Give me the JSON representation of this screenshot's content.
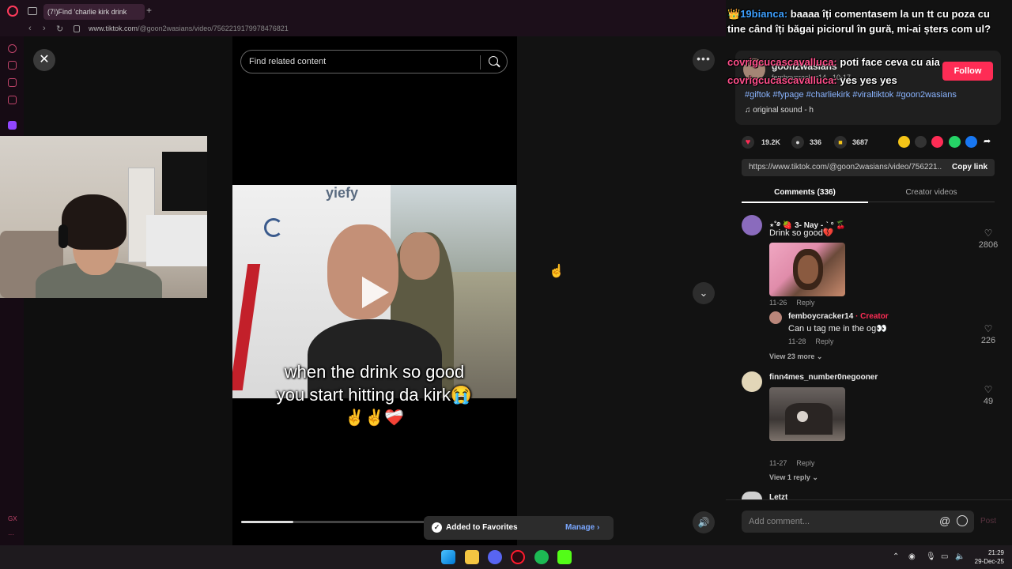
{
  "browser": {
    "tab_title": "(7!)Find 'charlie kirk drink",
    "url_host": "www.tiktok.com",
    "url_path": "/@goon2wasians/video/7562219179978476821"
  },
  "search": {
    "placeholder": "Find related content"
  },
  "video": {
    "caption_line1": "when the drink so good",
    "caption_line2": "you start hitting da kirk😭",
    "caption_emoji": "✌️✌️❤️‍🩹",
    "brand_text": "yiefy",
    "progress": 0.2
  },
  "toast": {
    "message": "Added to Favorites",
    "action": "Manage",
    "chevron": "›"
  },
  "controls": {
    "close": "✕",
    "more": "•••",
    "down": "⌄",
    "volume": "🔊"
  },
  "post": {
    "author": "goon2wasians",
    "author_sub": "femboycracker14 · 10-17",
    "follow_label": "Follow",
    "hashtags": "#giftok #fypage #charliekirk #viraltiktok #goon2wasians",
    "sound": "original sound - h",
    "likes": "19.2K",
    "comments": "336",
    "saves": "3687",
    "share_url": "https://www.tiktok.com/@goon2wasians/video/756221...",
    "copy_link_label": "Copy link"
  },
  "chat_overlay": [
    {
      "nick": "19bianca:",
      "text": "baaaa îți comentasem la un tt cu poza cu",
      "nick_color": "#3ea0ff"
    },
    {
      "nick": "",
      "text": "tine când îți băgai piciorul în gură, mi-ai șters com ul?",
      "nick_color": "#3ea0ff"
    },
    {
      "nick": "covrigcucascavalluca:",
      "text": "poti face ceva cu aia",
      "nick_color": "#ff4f8b"
    },
    {
      "nick": "covrigcucascavalluca:",
      "text": "yes yes yes",
      "nick_color": "#ff4f8b"
    }
  ],
  "tabs": {
    "comments": "Comments (336)",
    "creator": "Creator videos"
  },
  "comments": [
    {
      "name": "⋆˚࿔ 🍓 3- Nay -ˏˋ ° 🍒",
      "text": "Drink so good💔",
      "date": "11-26",
      "reply": "Reply",
      "likes": "2806"
    },
    {
      "name": "femboycracker14",
      "creator_tag": "· Creator",
      "text": "Can u tag me in the og👀",
      "date": "11-28",
      "reply": "Reply",
      "likes": "226"
    },
    {
      "view_more": "View 23 more ⌄"
    },
    {
      "name": "finn4mes_number0negooner",
      "date": "11-27",
      "reply": "Reply",
      "likes": "49",
      "view_more": "View 1 reply ⌄"
    },
    {
      "name": "Letzt"
    }
  ],
  "add_comment": {
    "placeholder": "Add comment...",
    "at": "@",
    "post_label": "Post"
  },
  "taskbar": {
    "time": "21:29",
    "date": "29-Dec-25"
  },
  "sidebar": {
    "gx_label": "GX",
    "more_label": "···"
  },
  "colors": {
    "accent": "#fe2c55",
    "link": "#8ab4ff"
  }
}
